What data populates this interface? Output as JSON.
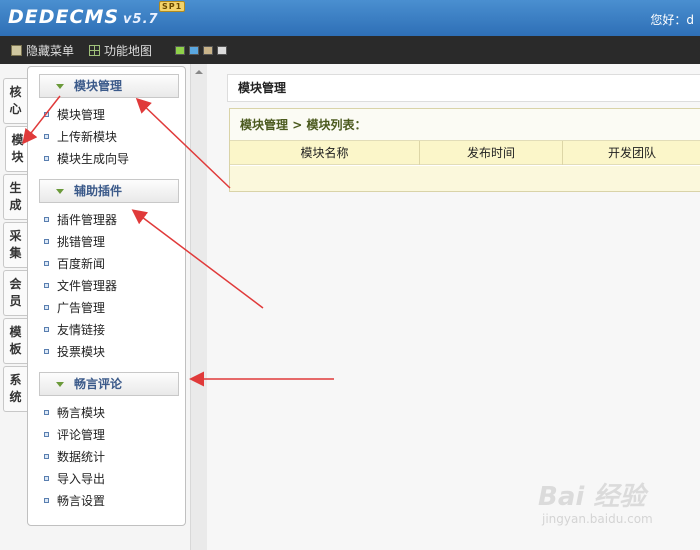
{
  "header": {
    "logo_text": "DEDECMS",
    "version": "v5.7",
    "badge": "SP1",
    "greeting": "您好：d"
  },
  "toolbar": {
    "hide_menu_label": "隐藏菜单",
    "site_map_label": "功能地图",
    "swatches": [
      "#8fd14a",
      "#5aa7e0",
      "#c9b48a",
      "#dcdcdc"
    ]
  },
  "side_tabs": [
    "核心",
    "模块",
    "生成",
    "采集",
    "会员",
    "模板",
    "系统"
  ],
  "menu": {
    "groups": [
      {
        "title": "模块管理",
        "items": [
          "模块管理",
          "上传新模块",
          "模块生成向导"
        ]
      },
      {
        "title": "辅助插件",
        "items": [
          "插件管理器",
          "挑错管理",
          "百度新闻",
          "文件管理器",
          "广告管理",
          "友情链接",
          "投票模块"
        ]
      },
      {
        "title": "畅言评论",
        "items": [
          "畅言模块",
          "评论管理",
          "数据统计",
          "导入导出",
          "畅言设置"
        ]
      }
    ]
  },
  "main": {
    "title": "模块管理",
    "breadcrumb": [
      "模块管理",
      ">",
      "模块列表："
    ],
    "columns": [
      "模块名称",
      "发布时间",
      "开发团队"
    ]
  },
  "watermark": {
    "brand": "Bai 经验",
    "url": "jingyan.baidu.com"
  },
  "colors": {
    "header": "#3b80c6",
    "toolbar": "#2a2a2a",
    "annotation_arrow": "#e03a3a",
    "table_header": "#fbf6c9"
  }
}
